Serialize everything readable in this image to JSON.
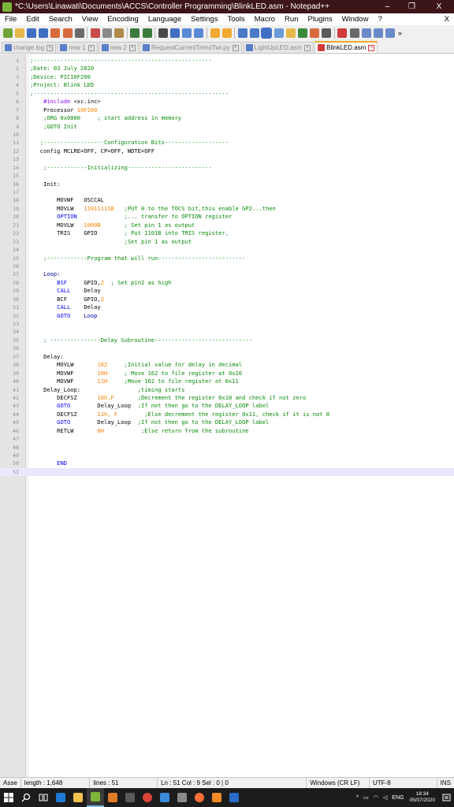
{
  "window": {
    "title": "*C:\\Users\\Linawati\\Documents\\ACCS\\Controller Programming\\BlinkLED.asm - Notepad++",
    "minimize_glyph": "–",
    "maximize_glyph": "❐",
    "close_glyph": "X"
  },
  "menu": {
    "items": [
      "File",
      "Edit",
      "Search",
      "View",
      "Encoding",
      "Language",
      "Settings",
      "Tools",
      "Macro",
      "Run",
      "Plugins",
      "Window",
      "?"
    ],
    "close_doc": "X"
  },
  "toolbar": {
    "more": "»"
  },
  "tabs": [
    {
      "label": "change.log",
      "active": false
    },
    {
      "label": "new 1",
      "active": false
    },
    {
      "label": "new 2",
      "active": false
    },
    {
      "label": "RequestCurrentTrendTwi.py",
      "active": false
    },
    {
      "label": "LightUpLED.asm",
      "active": false
    },
    {
      "label": "BlinkLED.asm",
      "active": true
    }
  ],
  "editor": {
    "current_line": 51,
    "lines": [
      [
        [
          "c-comment",
          ";-----------------------------------------------------"
        ]
      ],
      [
        [
          "c-comment",
          ";Date: 03 July 2020"
        ]
      ],
      [
        [
          "c-comment",
          ";Device: PIC10F200"
        ]
      ],
      [
        [
          "c-comment",
          ";Project: Blink LED"
        ]
      ],
      [
        [
          "c-comment",
          ";----------------------------------------------------------"
        ]
      ],
      [
        [
          "c-dark",
          "    "
        ],
        [
          "c-dir",
          "#include"
        ],
        [
          "c-dark",
          " <xc.inc>"
        ]
      ],
      [
        [
          "c-dark",
          "    Processor "
        ],
        [
          "c-num",
          "10F200"
        ]
      ],
      [
        [
          "c-dark",
          "    "
        ],
        [
          "c-comment",
          ";ORG 0x0000     ; start address in memory"
        ]
      ],
      [
        [
          "c-dark",
          "    "
        ],
        [
          "c-comment",
          ";GOTO Init"
        ]
      ],
      [
        [
          "c-dark",
          ""
        ]
      ],
      [
        [
          "c-dark",
          "   "
        ],
        [
          "c-comment",
          ";------------------Configuration Bits-------------------"
        ]
      ],
      [
        [
          "c-dark",
          "   config MCLRE=OFF, CP=OFF, WDTE=OFF"
        ]
      ],
      [
        [
          "c-dark",
          ""
        ]
      ],
      [
        [
          "c-dark",
          "    "
        ],
        [
          "c-comment",
          ";------------Initializing-------------------------"
        ]
      ],
      [
        [
          "c-dark",
          ""
        ]
      ],
      [
        [
          "c-dark",
          "    Init:"
        ]
      ],
      [
        [
          "c-dark",
          ""
        ]
      ],
      [
        [
          "c-dark",
          "        MOVWF   OSCCAL"
        ]
      ],
      [
        [
          "c-dark",
          "        MOVLW   "
        ],
        [
          "c-num",
          "11011111B"
        ],
        [
          "c-dark",
          "   "
        ],
        [
          "c-comment",
          ";PUT 0 to the TOCS bit,this enable GP2...then"
        ]
      ],
      [
        [
          "c-dark",
          "        "
        ],
        [
          "c-kw",
          "OPTION"
        ],
        [
          "c-dark",
          "              "
        ],
        [
          "c-comment",
          ";... transfer to OPTION register"
        ]
      ],
      [
        [
          "c-dark",
          "        MOVLW   "
        ],
        [
          "c-num",
          "1000B"
        ],
        [
          "c-dark",
          "       "
        ],
        [
          "c-comment",
          "; Set pin 1 as output"
        ]
      ],
      [
        [
          "c-dark",
          "        TRIS    GPIO        "
        ],
        [
          "c-comment",
          "; Put 1101B into TRIS register,"
        ]
      ],
      [
        [
          "c-dark",
          "                            "
        ],
        [
          "c-comment",
          ";Set pin 1 as output"
        ]
      ],
      [
        [
          "c-dark",
          ""
        ]
      ],
      [
        [
          "c-dark",
          "    "
        ],
        [
          "c-comment",
          ";------------Program that will run--------------------------"
        ]
      ],
      [
        [
          "c-dark",
          ""
        ]
      ],
      [
        [
          "c-lbl",
          "    Loop:"
        ]
      ],
      [
        [
          "c-dark",
          "        "
        ],
        [
          "c-kw",
          "BSF"
        ],
        [
          "c-dark",
          "     GPIO,"
        ],
        [
          "c-num",
          "2"
        ],
        [
          "c-dark",
          "  "
        ],
        [
          "c-comment",
          "; Set pin2 as high"
        ]
      ],
      [
        [
          "c-dark",
          "        "
        ],
        [
          "c-kw",
          "CALL"
        ],
        [
          "c-dark",
          "    Delay"
        ]
      ],
      [
        [
          "c-dark",
          "        BCF     GPIO,"
        ],
        [
          "c-num",
          "2"
        ]
      ],
      [
        [
          "c-dark",
          "        "
        ],
        [
          "c-kw",
          "CALL"
        ],
        [
          "c-dark",
          "    Delay"
        ]
      ],
      [
        [
          "c-dark",
          "        "
        ],
        [
          "c-kw",
          "GOTO"
        ],
        [
          "c-dark",
          "    "
        ],
        [
          "c-lbl",
          "Loop"
        ]
      ],
      [
        [
          "c-dark",
          ""
        ]
      ],
      [
        [
          "c-dark",
          ""
        ]
      ],
      [
        [
          "c-dark",
          "    "
        ],
        [
          "c-comment",
          "; ---------------Delay Subroutine-----------------------------"
        ]
      ],
      [
        [
          "c-dark",
          ""
        ]
      ],
      [
        [
          "c-dark",
          "    Delay:"
        ]
      ],
      [
        [
          "c-dark",
          "        MOVLW       "
        ],
        [
          "c-num",
          "162"
        ],
        [
          "c-dark",
          "     "
        ],
        [
          "c-comment",
          ";Initial value for delay in decimal"
        ]
      ],
      [
        [
          "c-dark",
          "        MOVWF       "
        ],
        [
          "c-num",
          "10H"
        ],
        [
          "c-dark",
          "     "
        ],
        [
          "c-comment",
          "; Move 162 to file register at 0x10"
        ]
      ],
      [
        [
          "c-dark",
          "        MOVWF       "
        ],
        [
          "c-num",
          "11H"
        ],
        [
          "c-dark",
          "     "
        ],
        [
          "c-comment",
          ";Move 162 to file register at 0x11"
        ]
      ],
      [
        [
          "c-dark",
          "    Delay_Loop:                 "
        ],
        [
          "c-comment",
          ";timing starts"
        ]
      ],
      [
        [
          "c-dark",
          "        DECFSZ      "
        ],
        [
          "c-num",
          "10h,F"
        ],
        [
          "c-dark",
          "       "
        ],
        [
          "c-comment",
          ";Decrement the register 0x10 and check if not zero"
        ]
      ],
      [
        [
          "c-dark",
          "        "
        ],
        [
          "c-kw",
          "GOTO"
        ],
        [
          "c-dark",
          "        Delay_Loop  "
        ],
        [
          "c-comment",
          ";If not then go to the DELAY_LOOP label"
        ]
      ],
      [
        [
          "c-dark",
          "        DECFSZ      "
        ],
        [
          "c-num",
          "11h, F"
        ],
        [
          "c-dark",
          "        "
        ],
        [
          "c-comment",
          ";Else decrement the register 0x11, check if it is not 0"
        ]
      ],
      [
        [
          "c-dark",
          "        "
        ],
        [
          "c-kw",
          "GOTO"
        ],
        [
          "c-dark",
          "        Delay_Loop  "
        ],
        [
          "c-comment",
          ";If not then go to the DELAY_LOOP label"
        ]
      ],
      [
        [
          "c-dark",
          "        RETLW       "
        ],
        [
          "c-num",
          "0H"
        ],
        [
          "c-dark",
          "           "
        ],
        [
          "c-comment",
          ";Else return from the subroutine"
        ]
      ],
      [
        [
          "c-dark",
          ""
        ]
      ],
      [
        [
          "c-dark",
          ""
        ]
      ],
      [
        [
          "c-dark",
          ""
        ]
      ],
      [
        [
          "c-dark",
          "        "
        ],
        [
          "c-kw",
          "END"
        ]
      ],
      [
        [
          "c-dark",
          ""
        ]
      ]
    ]
  },
  "status": {
    "type": "Asse",
    "length": "length : 1,648",
    "lines": "lines : 51",
    "position": "Ln : 51    Col : 9    Sel : 0 | 0",
    "eol": "Windows (CR LF)",
    "encoding": "UTF-8",
    "mode": "INS"
  },
  "taskbar": {
    "time": "18:34",
    "date": "05/07/2020",
    "lang": "ENG"
  }
}
